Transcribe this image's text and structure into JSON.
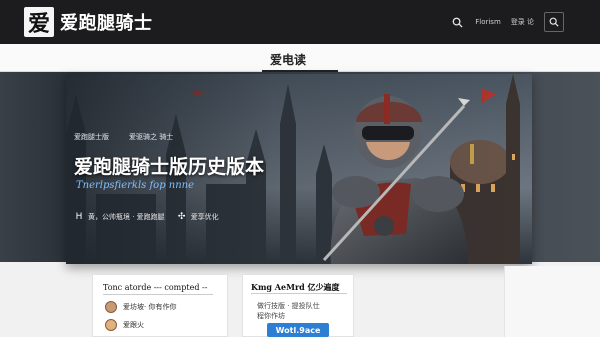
{
  "header": {
    "logo_mark": "爱",
    "logo_text": "爱跑腿骑士",
    "nav_link": "Florism",
    "nav_box_label": "登录 论"
  },
  "section": {
    "title": "爱电读"
  },
  "hero": {
    "eyebrow": [
      "爱跑腿士版",
      "爱驱骑之 骑士"
    ],
    "title": "爱跑腿骑士版历史版本",
    "subtitle": "Tnerlpsfierkls fop nnne",
    "meta": [
      {
        "icon": "H",
        "text": "黄，公帅瓶境 · 爱跑跑腿"
      },
      {
        "icon": "✣",
        "text": "爱享优化"
      }
    ]
  },
  "cards": {
    "left": {
      "title": "Tonc atorde --- compted --",
      "rows": [
        "爱坊坡· 你有作你",
        "爱跟火"
      ]
    },
    "mid": {
      "title": "Kmg AeMrd 亿少遍度",
      "lines": [
        "做行技版 · 提投队仕",
        "程你作坊"
      ],
      "badge": "Wotl.9ace"
    }
  },
  "colors": {
    "topbar": "#1c1c1e",
    "accent_blue": "#2c7fd3",
    "subtitle_blue": "#7fc0ff"
  }
}
